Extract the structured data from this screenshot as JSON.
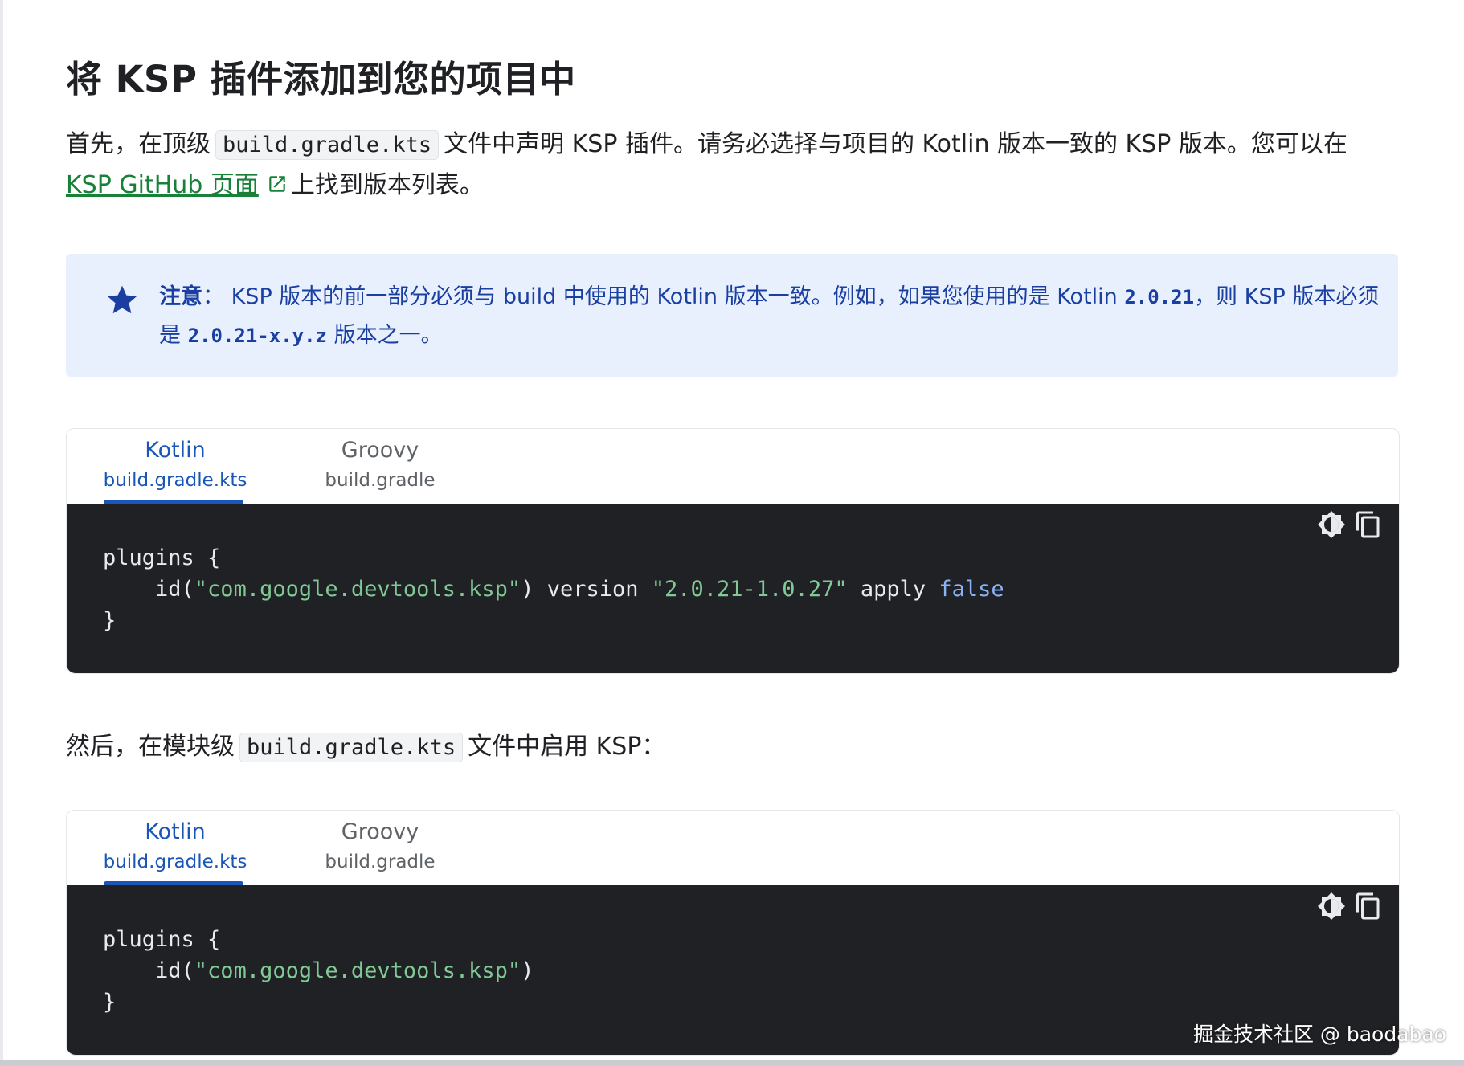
{
  "heading": "将 KSP 插件添加到您的项目中",
  "intro": {
    "text_before": "首先，在顶级",
    "code": "build.gradle.kts",
    "text_after": "文件中声明 KSP 插件。请务必选择与项目的 Kotlin 版本一致的 KSP 版本。您可以在",
    "link_text": "KSP GitHub 页面",
    "text_end": "上找到版本列表。"
  },
  "note": {
    "label": "注意",
    "sep": "：",
    "text1": "KSP 版本的前一部分必须与 build 中使用的 Kotlin 版本一致。例如，如果您使用的是 Kotlin ",
    "code1": "2.0.21",
    "text2": "，则 KSP 版本必须",
    "text3": "是 ",
    "code2": "2.0.21-x.y.z",
    "text4": " 版本之一。"
  },
  "block1": {
    "tabs": [
      {
        "name": "Kotlin",
        "file": "build.gradle.kts",
        "active": true
      },
      {
        "name": "Groovy",
        "file": "build.gradle",
        "active": false
      }
    ],
    "code": {
      "l1": "plugins {",
      "l2_pre": "    id(",
      "l2_str": "\"com.google.devtools.ksp\"",
      "l2_mid": ") version ",
      "l2_ver": "\"2.0.21-1.0.27\"",
      "l2_apply": " apply ",
      "l2_false": "false",
      "l3": "}"
    }
  },
  "middle": {
    "text_before": "然后，在模块级",
    "code": "build.gradle.kts",
    "text_after": "文件中启用 KSP："
  },
  "block2": {
    "tabs": [
      {
        "name": "Kotlin",
        "file": "build.gradle.kts",
        "active": true
      },
      {
        "name": "Groovy",
        "file": "build.gradle",
        "active": false
      }
    ],
    "code": {
      "l1": "plugins {",
      "l2_pre": "    id(",
      "l2_str": "\"com.google.devtools.ksp\"",
      "l2_end": ")",
      "l3": "}"
    }
  },
  "icons": {
    "note": "star-icon",
    "link": "external-link-icon",
    "theme": "theme-toggle-icon",
    "copy": "copy-icon"
  },
  "colors": {
    "accent": "#1a56b8",
    "link": "#188038",
    "note_bg": "#e8f0fe",
    "code_bg": "#202124",
    "code_string": "#81c995",
    "code_keyword": "#8ab4f8"
  },
  "watermark": "掘金技术社区 @ baodabao"
}
